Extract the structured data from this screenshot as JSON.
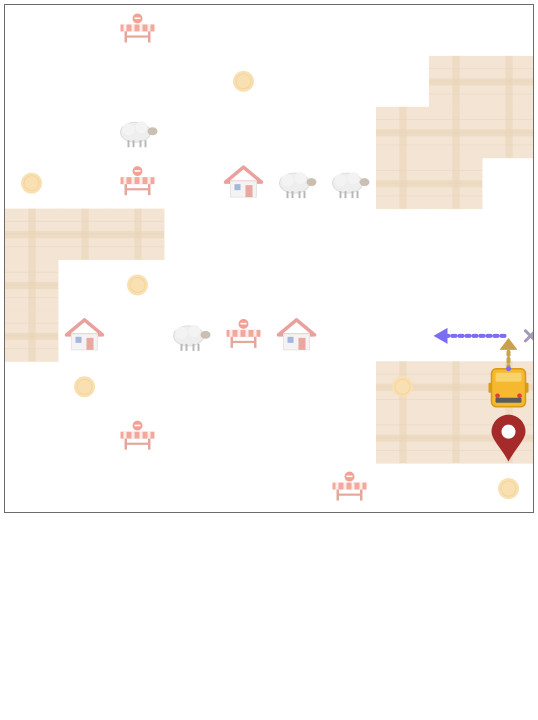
{
  "game": {
    "grid": {
      "cols": 10,
      "rows": 10
    },
    "colors": {
      "road": "#f3e4d3",
      "road_stripe": "#e9d3b7",
      "coin": "#f9e0b3",
      "roadblock": "#f08a7a",
      "house_roof": "#e48a84",
      "player_car": "#f5b82e",
      "destination_pin": "#a52a2a",
      "left_arrow": "#7b6cf6",
      "up_arrow": "#c8a24a",
      "cross": "#a79ab4"
    },
    "road_tiles": [
      [
        8,
        1
      ],
      [
        9,
        1
      ],
      [
        7,
        2
      ],
      [
        8,
        2
      ],
      [
        9,
        2
      ],
      [
        7,
        3
      ],
      [
        8,
        3
      ],
      [
        0,
        4
      ],
      [
        1,
        4
      ],
      [
        2,
        4
      ],
      [
        0,
        5
      ],
      [
        0,
        6
      ],
      [
        7,
        7
      ],
      [
        8,
        7
      ],
      [
        9,
        7
      ],
      [
        7,
        8
      ],
      [
        8,
        8
      ],
      [
        9,
        8
      ]
    ],
    "coins": [
      [
        4,
        1
      ],
      [
        0,
        3
      ],
      [
        2,
        5
      ],
      [
        1,
        7
      ],
      [
        7,
        7
      ],
      [
        9,
        9
      ]
    ],
    "roadblocks": [
      [
        2,
        0
      ],
      [
        2,
        3
      ],
      [
        4,
        6
      ],
      [
        2,
        8
      ],
      [
        6,
        9
      ]
    ],
    "sheep": [
      [
        2,
        2
      ],
      [
        5,
        3
      ],
      [
        6,
        3
      ],
      [
        3,
        6
      ]
    ],
    "houses": [
      [
        4,
        3
      ],
      [
        1,
        6
      ],
      [
        5,
        6
      ]
    ],
    "player": {
      "col": 9,
      "row": 7,
      "icon": "school-bus-icon"
    },
    "destination": {
      "col": 9,
      "row": 8,
      "icon": "map-pin-icon"
    },
    "move_hints": {
      "left": {
        "from": [
          9,
          6
        ],
        "to": [
          8,
          6
        ],
        "icon": "dotted-left-arrow-icon"
      },
      "up": {
        "from": [
          9,
          7
        ],
        "to": [
          9,
          6
        ],
        "icon": "dotted-up-arrow-icon"
      },
      "right_blocked": {
        "at": [
          9,
          6
        ],
        "icon": "x-mark-icon"
      }
    }
  }
}
